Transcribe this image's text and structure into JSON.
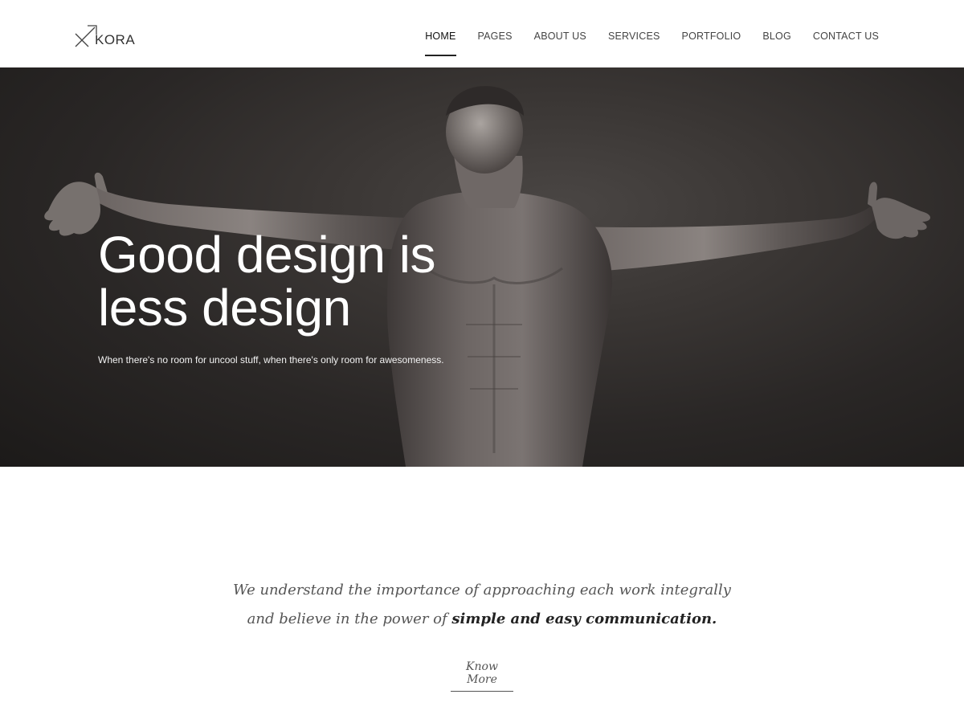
{
  "header": {
    "logo_text": "KORA",
    "nav": [
      {
        "label": "HOME",
        "active": true
      },
      {
        "label": "PAGES"
      },
      {
        "label": "ABOUT US"
      },
      {
        "label": "SERVICES"
      },
      {
        "label": "PORTFOLIO"
      },
      {
        "label": "BLOG"
      },
      {
        "label": "CONTACT US"
      }
    ]
  },
  "hero": {
    "title_line1": "Good design is",
    "title_line2": "less design",
    "subtitle": "When there's no room for uncool stuff, when there's only room for awesomeness."
  },
  "intro": {
    "line1": "We understand the importance of approaching each work integrally",
    "line2_regular": "and believe in the power of ",
    "line2_bold": "simple and easy communication.",
    "button": "Know More"
  },
  "colors": {
    "hero_background": "#2a2726",
    "text_dark": "#222222",
    "text_muted": "#555555"
  }
}
